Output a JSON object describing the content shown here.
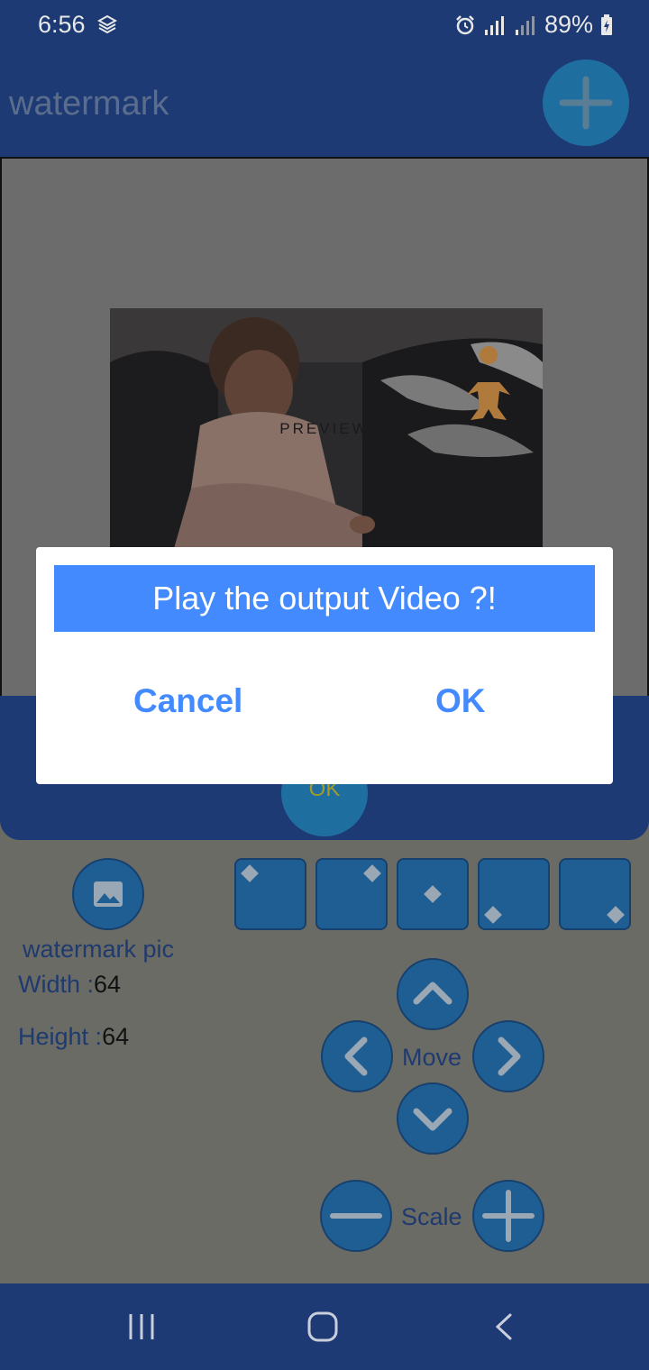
{
  "status_bar": {
    "time": "6:56",
    "battery": "89%"
  },
  "app_bar": {
    "title": "watermark"
  },
  "preview": {
    "label": "PREVIEW"
  },
  "panel": {
    "ok_label": "OK"
  },
  "controls": {
    "watermark_pic_label": "watermark pic",
    "width_label": "Width :",
    "width_value": "64",
    "height_label": "Height :",
    "height_value": "64",
    "move_label": "Move",
    "scale_label": "Scale"
  },
  "dialog": {
    "title": "Play the output Video ?!",
    "cancel_label": "Cancel",
    "ok_label": "OK"
  },
  "colors": {
    "app_bar": "#1d3a74",
    "accent": "#448aff",
    "button": "#1f5e92"
  }
}
